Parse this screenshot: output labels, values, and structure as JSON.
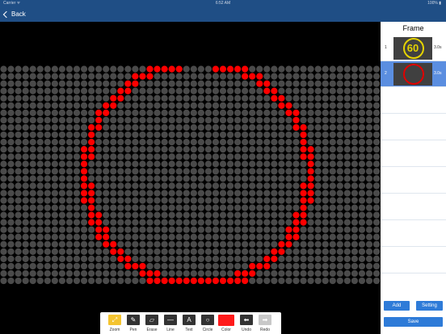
{
  "status_bar": {
    "carrier": "Carrier ᯤ",
    "time": "6:52 AM",
    "battery": "100% ▮"
  },
  "nav": {
    "back_label": "Back"
  },
  "side_panel": {
    "title": "Frame",
    "frames": [
      {
        "index": "1",
        "duration": "3.0s",
        "thumb_text": "60",
        "thumb_color": "#e5d300"
      },
      {
        "index": "2",
        "duration": "3.0s",
        "thumb_text": "",
        "thumb_color": "#e00000"
      }
    ],
    "add_label": "Add",
    "setting_label": "Setting",
    "save_label": "Save"
  },
  "toolbar": {
    "tools": [
      {
        "label": "Zoom",
        "icon": "zoom-icon"
      },
      {
        "label": "Pen",
        "icon": "pen-icon"
      },
      {
        "label": "Erase",
        "icon": "eraser-icon"
      },
      {
        "label": "Line",
        "icon": "line-icon"
      },
      {
        "label": "Text",
        "icon": "text-icon"
      },
      {
        "label": "Circle",
        "icon": "circle-icon"
      },
      {
        "label": "Color",
        "icon": "color-swatch-icon"
      },
      {
        "label": "Undo",
        "icon": "undo-arrow-icon"
      },
      {
        "label": "Redo",
        "icon": "redo-arrow-icon"
      }
    ]
  },
  "led_board": {
    "columns": 52,
    "rows": 30,
    "off_color": "#4a4a4a",
    "on_color": "#ff0000",
    "drawn_shape": "circle"
  }
}
